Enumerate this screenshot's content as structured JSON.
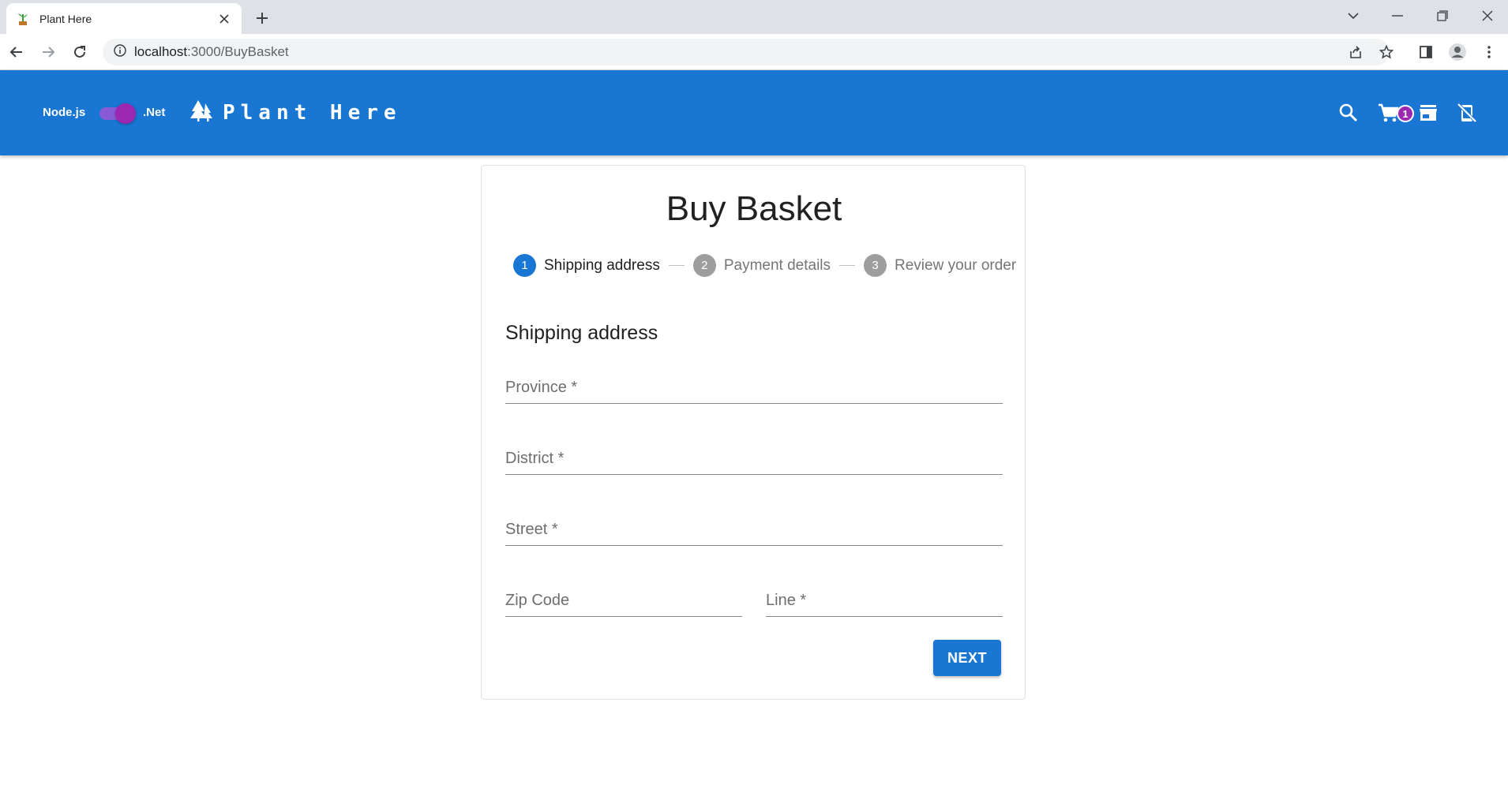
{
  "browser": {
    "tab_title": "Plant Here",
    "url_host": "localhost",
    "url_rest": ":3000/BuyBasket"
  },
  "appbar": {
    "switch_left_label": "Node.js",
    "switch_right_label": ".Net",
    "switch_on": true,
    "brand": "Plant Here",
    "cart_count": "1",
    "color": "#1976d2"
  },
  "page": {
    "title": "Buy Basket",
    "steps": [
      {
        "number": "1",
        "label": "Shipping address",
        "active": true
      },
      {
        "number": "2",
        "label": "Payment details",
        "active": false
      },
      {
        "number": "3",
        "label": "Review your order",
        "active": false
      }
    ],
    "section_title": "Shipping address",
    "fields": {
      "province": "Province *",
      "district": "District *",
      "street": "Street *",
      "zip": "Zip Code",
      "line": "Line *"
    },
    "next_label": "NEXT"
  }
}
